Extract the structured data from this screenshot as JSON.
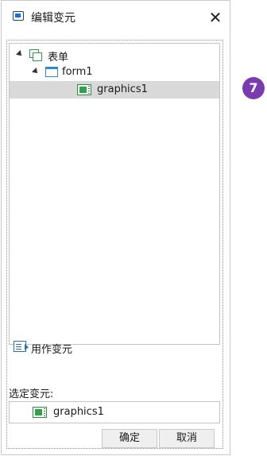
{
  "dialog": {
    "title": "编辑变元",
    "close_icon": "close-icon",
    "close_glyph": "✕"
  },
  "tree": {
    "root": {
      "label": "表单",
      "icon": "forms-icon",
      "expanded": true
    },
    "form": {
      "label": "form1",
      "icon": "folder-icon",
      "expanded": true
    },
    "item": {
      "label": "graphics1",
      "icon": "graphics-icon",
      "selected": true
    }
  },
  "use_as_variable": {
    "label": "用作变元",
    "icon": "use-as-variable-icon"
  },
  "selected_variable": {
    "label": "选定变元:",
    "value": "graphics1",
    "icon": "graphics-icon"
  },
  "buttons": {
    "ok": "确定",
    "cancel": "取消"
  },
  "callout": {
    "number": "7"
  },
  "colors": {
    "selection": "#d9d9d9",
    "badge": "#7a3bb0",
    "graphics_green": "#30a24b",
    "folder_blue": "#2d8ad6",
    "app_icon_blue": "#1d6fd1"
  }
}
